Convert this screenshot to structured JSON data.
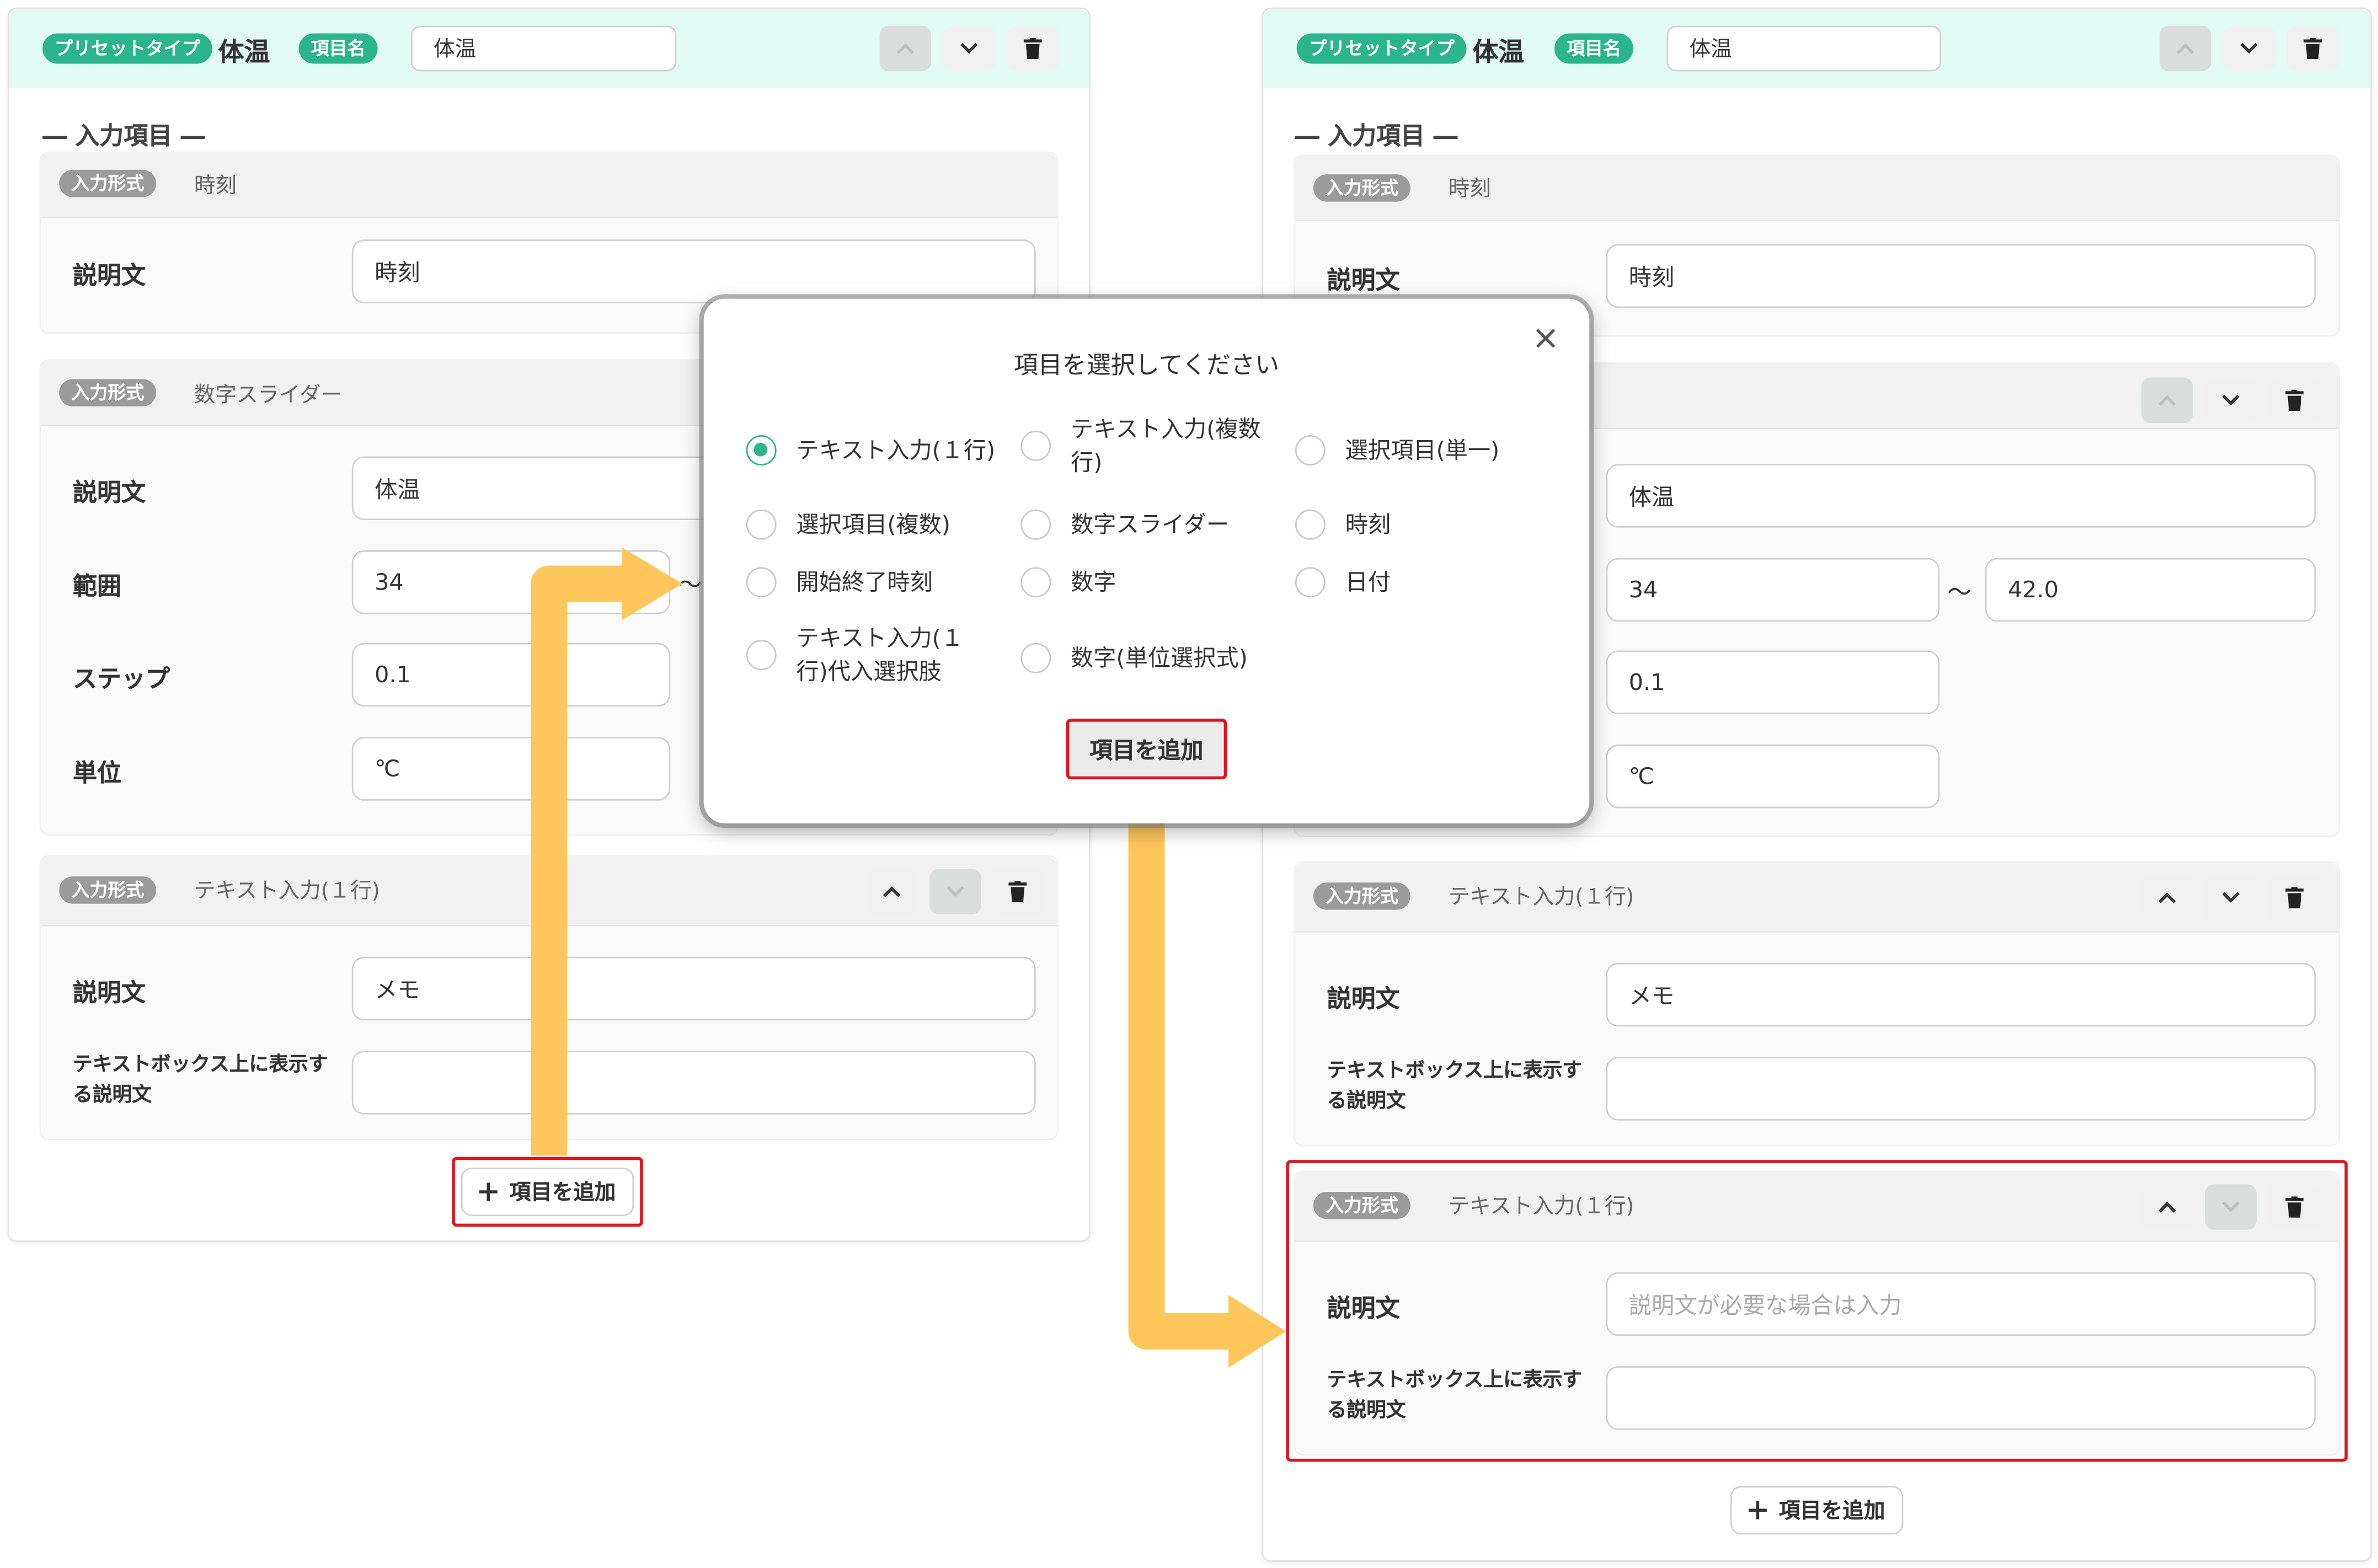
{
  "left_panel": {
    "preset_tag": "プリセットタイプ",
    "preset_value": "体温",
    "item_tag": "項目名",
    "item_value": "体温",
    "section_title": "― 入力項目 ―",
    "cards": [
      {
        "format_tag": "入力形式",
        "type": "時刻",
        "desc_label": "説明文",
        "desc_value": "時刻"
      },
      {
        "format_tag": "入力形式",
        "type": "数字スライダー",
        "desc_label": "説明文",
        "desc_value": "体温",
        "range_label": "範囲",
        "range_min": "34",
        "range_sep": "〜",
        "step_label": "ステップ",
        "step_value": "0.1",
        "unit_label": "単位",
        "unit_value": "℃"
      },
      {
        "format_tag": "入力形式",
        "type": "テキスト入力(１行)",
        "desc_label": "説明文",
        "desc_value": "メモ",
        "box_label": "テキストボックス上に表示する説明文",
        "box_value": ""
      }
    ],
    "add_button": "項目を追加"
  },
  "modal": {
    "title": "項目を選択してください",
    "close": "×",
    "options": [
      {
        "label": "テキスト入力(１行)",
        "selected": true
      },
      {
        "label": "テキスト入力(複数行)",
        "selected": false
      },
      {
        "label": "選択項目(単一)",
        "selected": false
      },
      {
        "label": "選択項目(複数)",
        "selected": false
      },
      {
        "label": "数字スライダー",
        "selected": false
      },
      {
        "label": "時刻",
        "selected": false
      },
      {
        "label": "開始終了時刻",
        "selected": false
      },
      {
        "label": "数字",
        "selected": false
      },
      {
        "label": "日付",
        "selected": false
      },
      {
        "label": "テキスト入力(１行)代入選択肢",
        "selected": false
      },
      {
        "label": "数字(単位選択式)",
        "selected": false
      }
    ],
    "add_button": "項目を追加"
  },
  "right_panel": {
    "preset_tag": "プリセットタイプ",
    "preset_value": "体温",
    "item_tag": "項目名",
    "item_value": "体温",
    "section_title": "― 入力項目 ―",
    "cards": [
      {
        "format_tag": "入力形式",
        "type": "時刻",
        "desc_label": "説明文",
        "desc_value": "時刻"
      },
      {
        "desc_value": "体温",
        "range_min": "34",
        "range_sep": "〜",
        "range_max": "42.0",
        "step_value": "0.1",
        "unit_value": "℃"
      },
      {
        "format_tag": "入力形式",
        "type": "テキスト入力(１行)",
        "desc_label": "説明文",
        "desc_value": "メモ",
        "box_label": "テキストボックス上に表示する説明文",
        "box_value": ""
      },
      {
        "format_tag": "入力形式",
        "type": "テキスト入力(１行)",
        "desc_label": "説明文",
        "desc_placeholder": "説明文が必要な場合は入力",
        "box_label": "テキストボックス上に表示する説明文",
        "box_value": ""
      }
    ],
    "add_button": "項目を追加"
  },
  "icons": {
    "up": "chevron-up-icon",
    "down": "chevron-down-icon",
    "delete": "trash-icon",
    "plus": "plus-icon",
    "close": "close-icon"
  },
  "colors": {
    "accent": "#2bb58a",
    "highlight": "#e0141e",
    "arrow": "#ffc65c",
    "header_bg": "#e2faf4"
  }
}
